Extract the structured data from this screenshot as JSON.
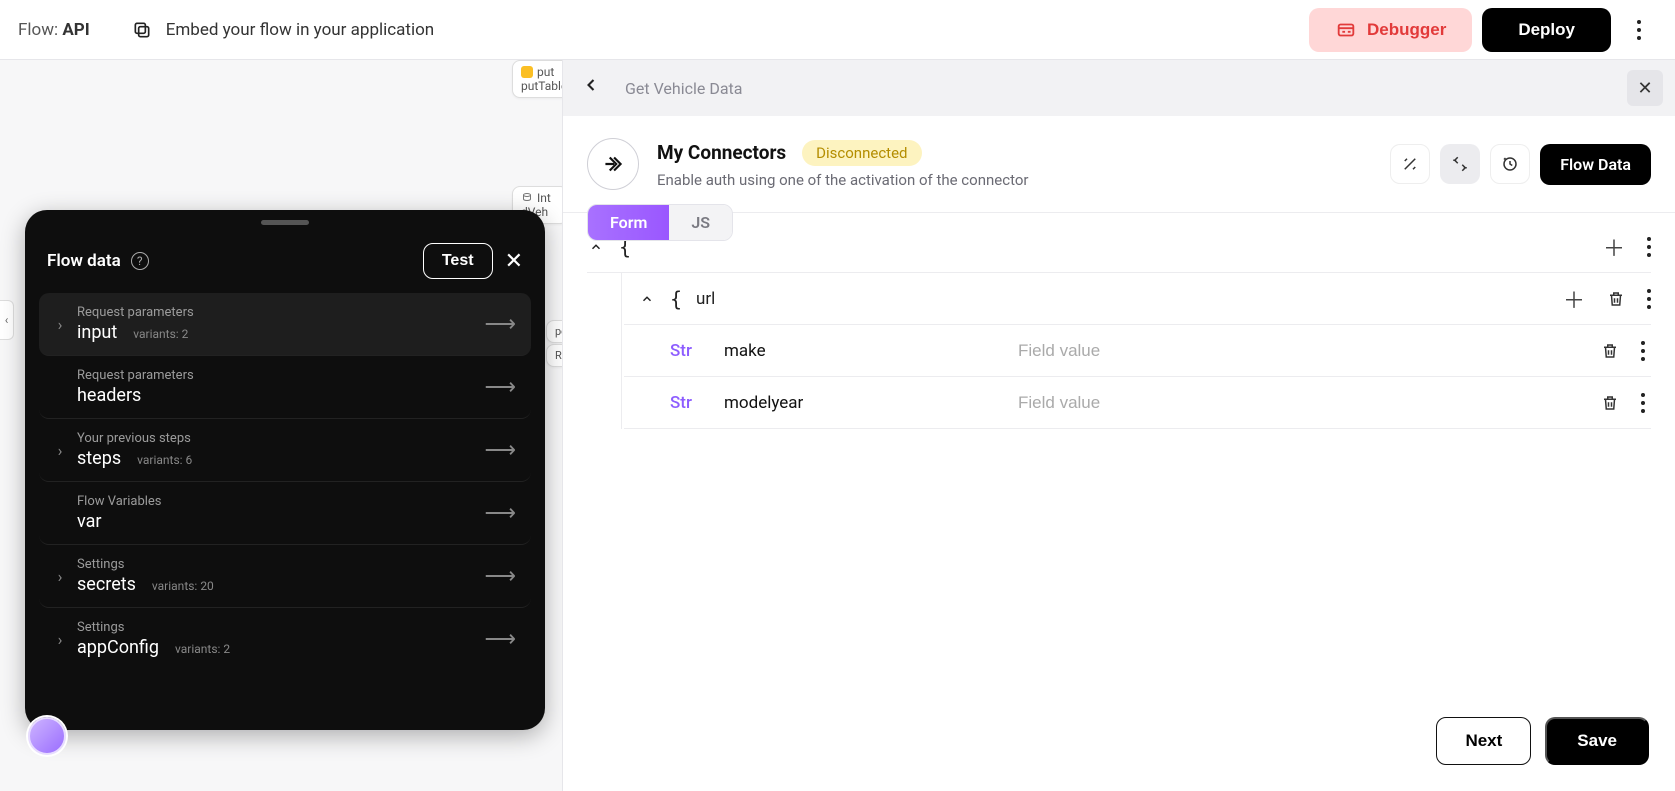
{
  "topbar": {
    "flow_label": "Flow:",
    "flow_name": "API",
    "embed_text": "Embed your flow in your application",
    "debugger_label": "Debugger",
    "deploy_label": "Deploy"
  },
  "canvas": {
    "node1a": "put",
    "node1b": "putTable",
    "node2a": "Int",
    "node2b": "dVeh",
    "node3": "pos",
    "node4": "Rov"
  },
  "flow_panel": {
    "title": "Flow data",
    "test_label": "Test",
    "items": [
      {
        "sub": "Request parameters",
        "name": "input",
        "variants": "variants: 2",
        "has_chev": true,
        "active": true
      },
      {
        "sub": "Request parameters",
        "name": "headers",
        "variants": "",
        "has_chev": false,
        "active": false
      },
      {
        "sub": "Your previous steps",
        "name": "steps",
        "variants": "variants: 6",
        "has_chev": true,
        "active": false
      },
      {
        "sub": "Flow Variables",
        "name": "var",
        "variants": "",
        "has_chev": false,
        "active": false
      },
      {
        "sub": "Settings",
        "name": "secrets",
        "variants": "variants: 20",
        "has_chev": true,
        "active": false
      },
      {
        "sub": "Settings",
        "name": "appConfig",
        "variants": "variants: 2",
        "has_chev": true,
        "active": false
      }
    ]
  },
  "main": {
    "breadcrumb": "Get Vehicle Data",
    "connector_name": "My Connectors",
    "badge": "Disconnected",
    "subtitle": "Enable auth using one of the activation of the connector",
    "tab_form": "Form",
    "tab_js": "JS",
    "flow_data_btn": "Flow Data",
    "tree": {
      "url_label": "url",
      "type_label": "Str",
      "rows": [
        {
          "key": "make",
          "placeholder": "Field value"
        },
        {
          "key": "modelyear",
          "placeholder": "Field value"
        }
      ]
    },
    "next_label": "Next",
    "save_label": "Save"
  }
}
